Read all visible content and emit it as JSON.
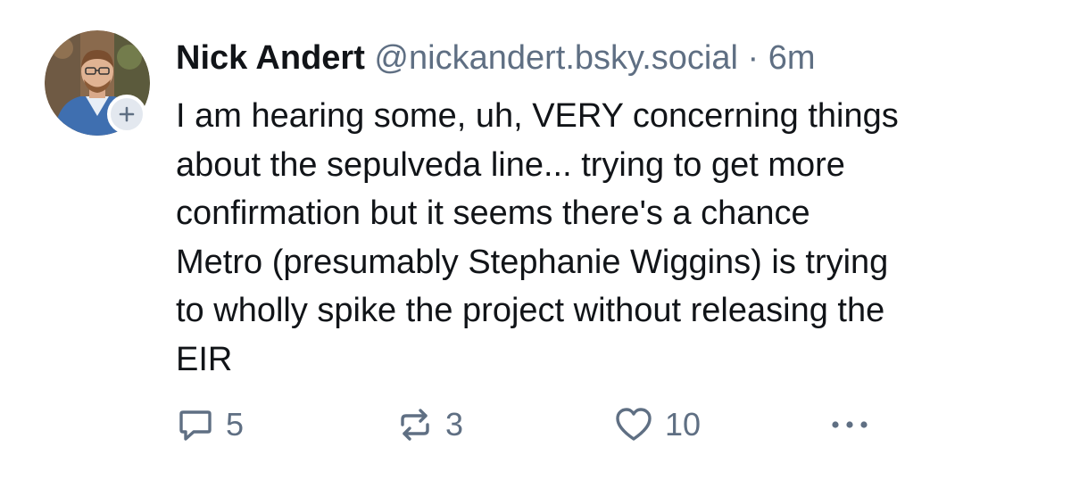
{
  "post": {
    "author": {
      "name": "Nick Andert",
      "handle": "@nickandert.bsky.social"
    },
    "separator": "·",
    "time": "6m",
    "body_lines": [
      "I am hearing some, uh, VERY concerning things",
      "about the sepulveda line... trying to get more",
      "confirmation but it seems there's a chance",
      "Metro (presumably Stephanie Wiggins) is trying",
      "to wholly spike the project without releasing the",
      "EIR"
    ],
    "actions": {
      "reply": {
        "icon": "reply-icon",
        "count": "5"
      },
      "repost": {
        "icon": "repost-icon",
        "count": "3"
      },
      "like": {
        "icon": "heart-icon",
        "count": "10"
      },
      "more": {
        "icon": "more-dots-icon"
      }
    }
  },
  "colors": {
    "text_primary": "#111418",
    "text_secondary": "#5f6f83",
    "follow_badge_bg": "#e3e8ef"
  }
}
